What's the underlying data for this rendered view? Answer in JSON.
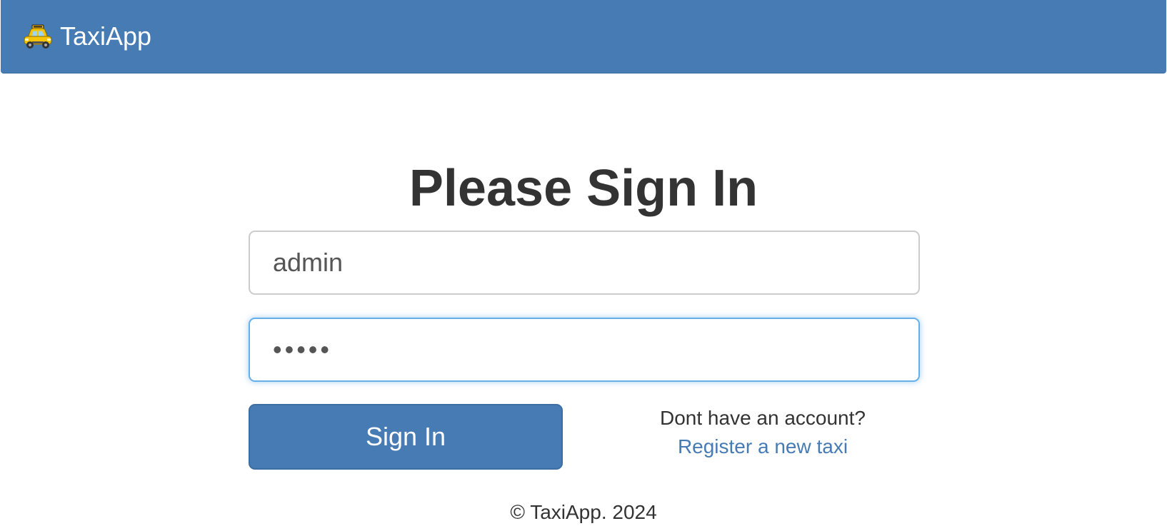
{
  "navbar": {
    "brand_icon": "taxi-icon",
    "brand_label": "TaxiApp",
    "background_color": "#467bb4"
  },
  "login": {
    "title": "Please Sign In",
    "username_value": "admin",
    "password_value": "•••••",
    "signin_label": "Sign In",
    "register_prompt": "Dont have an account?",
    "register_link": "Register a new taxi"
  },
  "footer": {
    "text": "© TaxiApp. 2024"
  },
  "colors": {
    "primary": "#467bb4",
    "focus_border": "#66afe9",
    "text": "#333333"
  }
}
